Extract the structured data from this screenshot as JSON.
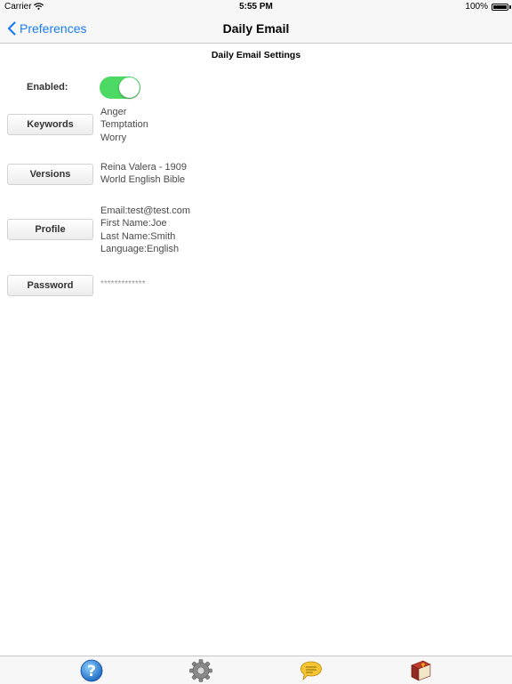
{
  "status_bar": {
    "carrier": "Carrier",
    "time": "5:55 PM",
    "battery": "100%"
  },
  "nav": {
    "back_label": "Preferences",
    "title": "Daily Email"
  },
  "settings": {
    "heading": "Daily Email Settings",
    "enabled_label": "Enabled:",
    "enabled": true,
    "keywords": {
      "button": "Keywords",
      "values": [
        "Anger",
        "Temptation",
        "Worry"
      ]
    },
    "versions": {
      "button": "Versions",
      "values": [
        "Reina Valera - 1909",
        "World English Bible"
      ]
    },
    "profile": {
      "button": "Profile",
      "values": [
        "Email:test@test.com",
        "First Name:Joe",
        "Last Name:Smith",
        "Language:English"
      ]
    },
    "password": {
      "button": "Password",
      "value": "*************"
    }
  },
  "tab_bar": {
    "items": [
      {
        "icon": "help-question-icon"
      },
      {
        "icon": "gear-icon"
      },
      {
        "icon": "speech-bubble-icon"
      },
      {
        "icon": "bible-book-icon"
      }
    ]
  },
  "colors": {
    "accent": "#1a7cf5",
    "toggle_on": "#4cd964"
  }
}
